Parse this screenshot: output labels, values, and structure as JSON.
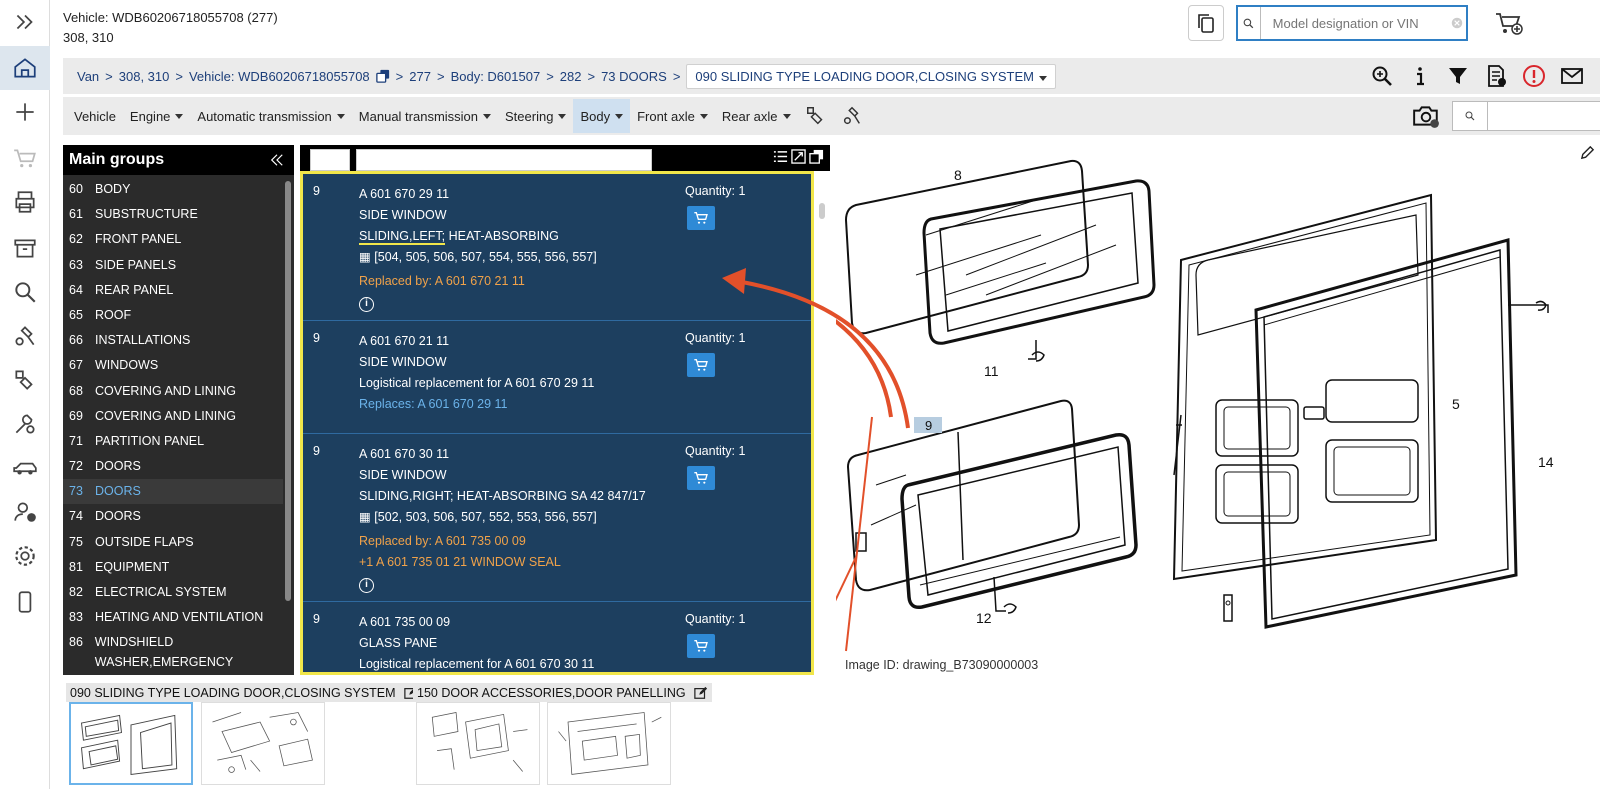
{
  "header": {
    "vehicle_line": "Vehicle: WDB60206718055708 (277)",
    "model_line": "308, 310",
    "search_placeholder": "Model designation or VIN"
  },
  "breadcrumb": {
    "items": [
      "Van",
      "308, 310",
      "Vehicle: WDB60206718055708",
      "277",
      "Body: D601507",
      "282",
      "73 DOORS"
    ],
    "current": "090 SLIDING TYPE LOADING DOOR,CLOSING SYSTEM"
  },
  "menu": {
    "items": [
      {
        "label": "Vehicle",
        "dropdown": false
      },
      {
        "label": "Engine",
        "dropdown": true
      },
      {
        "label": "Automatic transmission",
        "dropdown": true
      },
      {
        "label": "Manual transmission",
        "dropdown": true
      },
      {
        "label": "Steering",
        "dropdown": true
      },
      {
        "label": "Body",
        "dropdown": true,
        "active": true
      },
      {
        "label": "Front axle",
        "dropdown": true
      },
      {
        "label": "Rear axle",
        "dropdown": true
      }
    ]
  },
  "groups": {
    "title": "Main groups",
    "items": [
      {
        "num": "60",
        "label": "BODY"
      },
      {
        "num": "61",
        "label": "SUBSTRUCTURE"
      },
      {
        "num": "62",
        "label": "FRONT PANEL"
      },
      {
        "num": "63",
        "label": "SIDE PANELS"
      },
      {
        "num": "64",
        "label": "REAR PANEL"
      },
      {
        "num": "65",
        "label": "ROOF"
      },
      {
        "num": "66",
        "label": "INSTALLATIONS"
      },
      {
        "num": "67",
        "label": "WINDOWS"
      },
      {
        "num": "68",
        "label": "COVERING AND LINING"
      },
      {
        "num": "69",
        "label": "COVERING AND LINING"
      },
      {
        "num": "71",
        "label": "PARTITION PANEL"
      },
      {
        "num": "72",
        "label": "DOORS"
      },
      {
        "num": "73",
        "label": "DOORS"
      },
      {
        "num": "74",
        "label": "DOORS"
      },
      {
        "num": "75",
        "label": "OUTSIDE FLAPS"
      },
      {
        "num": "81",
        "label": "EQUIPMENT"
      },
      {
        "num": "82",
        "label": "ELECTRICAL SYSTEM"
      },
      {
        "num": "83",
        "label": "HEATING AND VENTILATION"
      },
      {
        "num": "86",
        "label": "WINDSHIELD WASHER,EMERGENCY EQUIPMT."
      }
    ]
  },
  "parts": [
    {
      "pos": "9",
      "number": "A 601 670 29 11",
      "name": "SIDE WINDOW",
      "desc_a": "SLIDING,LEFT;",
      "desc_b": " HEAT-ABSORBING",
      "codes": "[504, 505, 506, 507, 554, 555, 556, 557]",
      "replaced_by": "Replaced by: A 601 670 21 11",
      "quantity": "Quantity: 1"
    },
    {
      "pos": "9",
      "number": "A 601 670 21 11",
      "name": "SIDE WINDOW",
      "note": "Logistical replacement for A 601 670 29 11",
      "replaces": "Replaces: A 601 670 29 11",
      "quantity": "Quantity: 1"
    },
    {
      "pos": "9",
      "number": "A 601 670 30 11",
      "name": "SIDE WINDOW",
      "desc": "SLIDING,RIGHT; HEAT-ABSORBING SA 42 847/17",
      "codes": "[502, 503, 506, 507, 552, 553, 556, 557]",
      "replaced_by": "Replaced by: A 601 735 00 09",
      "extra": "+1 A 601 735 01 21 WINDOW SEAL",
      "quantity": "Quantity: 1"
    },
    {
      "pos": "9",
      "number": "A 601 735 00 09",
      "name": "GLASS PANE",
      "note": "Logistical replacement for A 601 670 30 11",
      "quantity": "Quantity: 1"
    }
  ],
  "drawing": {
    "image_id": "Image ID: drawing_B73090000003",
    "callouts": [
      "8",
      "11",
      "9",
      "12",
      "5",
      "14"
    ]
  },
  "thumbnails": {
    "group1_label": "090 SLIDING TYPE LOADING DOOR,CLOSING SYSTEM",
    "group2_label": "150 DOOR ACCESSORIES,DOOR PANELLING"
  },
  "colors": {
    "panel_bg": "#1d3f5f",
    "highlight": "#f1e64a",
    "accent": "#2f8ad6",
    "orange": "#f0a24a"
  }
}
